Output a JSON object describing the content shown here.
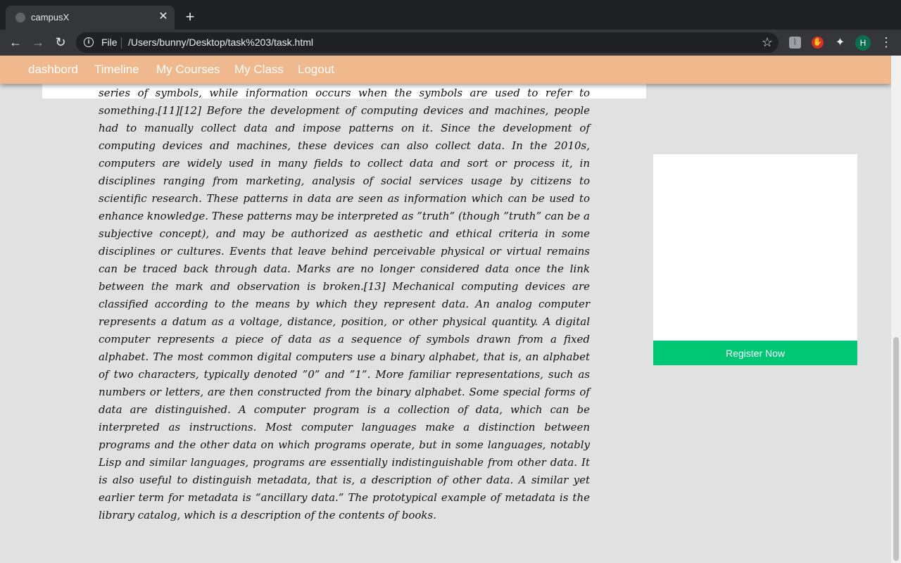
{
  "browser": {
    "tab_title": "campusX",
    "tab_close": "✕",
    "new_tab": "+",
    "back": "←",
    "forward": "→",
    "reload": "↻",
    "info": "i",
    "file_label": "File",
    "url": "/Users/bunny/Desktop/task%203/task.html",
    "star": "☆",
    "extensions": [
      "extension-icon",
      "adblock-icon",
      "puzzle-icon"
    ],
    "extension_glyphs": [
      "ᚱ",
      "✋",
      "✦"
    ],
    "avatar_initial": "H",
    "menu": "⋮"
  },
  "navbar": {
    "links": [
      "dashbord",
      "Timeline",
      "My Courses",
      "My Class",
      "Logout"
    ]
  },
  "article": {
    "text": "series of symbols, while information occurs when the symbols are used to refer to something.[11][12] Before the development of computing devices and machines, people had to manually collect data and impose patterns on it. Since the development of computing devices and machines, these devices can also collect data. In the 2010s, computers are widely used in many fields to collect data and sort or process it, in disciplines ranging from marketing, analysis of social services usage by citizens to scientific research. These patterns in data are seen as information which can be used to enhance knowledge. These patterns may be interpreted as ”truth” (though ”truth” can be a subjective concept), and may be authorized as aesthetic and ethical criteria in some disciplines or cultures. Events that leave behind perceivable physical or virtual remains can be traced back through data. Marks are no longer considered data once the link between the mark and observation is broken.[13] Mechanical computing devices are classified according to the means by which they represent data. An analog computer represents a datum as a voltage, distance, position, or other physical quantity. A digital computer represents a piece of data as a sequence of symbols drawn from a fixed alphabet. The most common digital computers use a binary alphabet, that is, an alphabet of two characters, typically denoted ”0” and ”1”. More familiar representations, such as numbers or letters, are then constructed from the binary alphabet. Some special forms of data are distinguished. A computer program is a collection of data, which can be interpreted as instructions. Most computer languages make a distinction between programs and the other data on which programs operate, but in some languages, notably Lisp and similar languages, programs are essentially indistinguishable from other data. It is also useful to distinguish metadata, that is, a description of other data. A similar yet earlier term for metadata is “ancillary data.” The prototypical example of metadata is the library catalog, which is a description of the contents of books."
  },
  "sidebar": {
    "register_label": "Register Now"
  },
  "colors": {
    "navbar": "#f0b88d",
    "register": "#00c774",
    "page_bg": "#e1e1e1"
  }
}
